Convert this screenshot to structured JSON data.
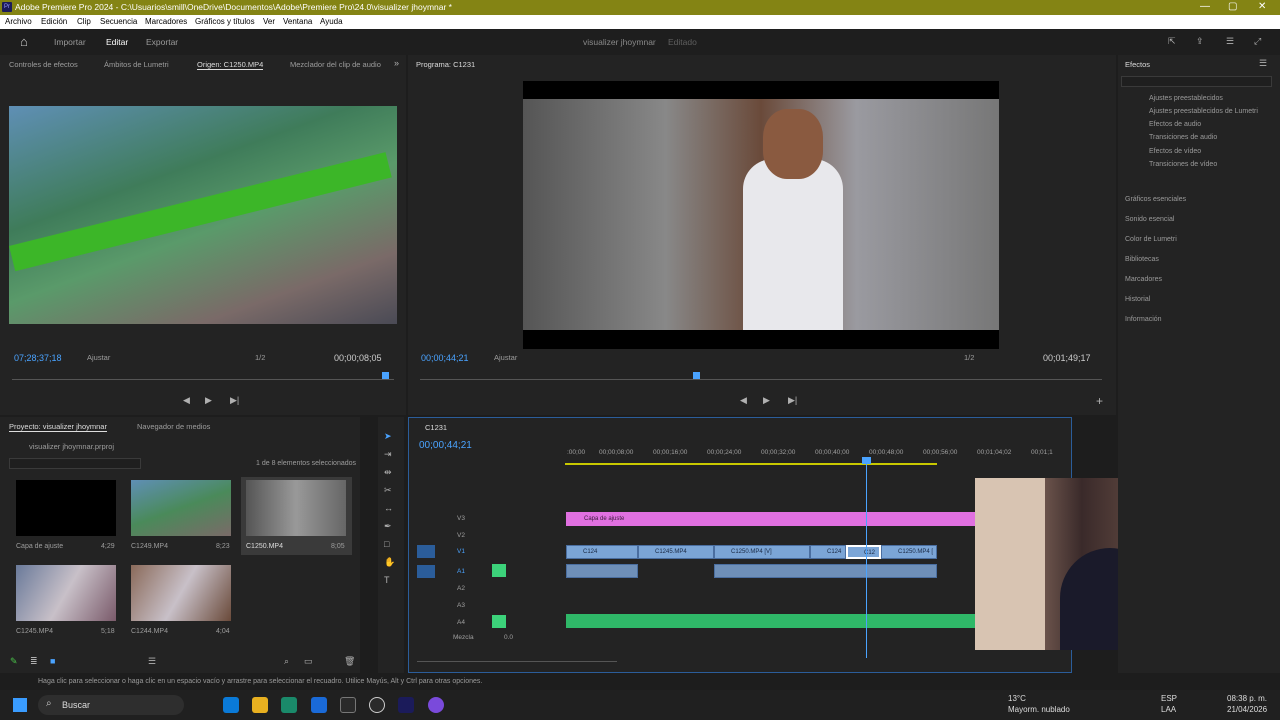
{
  "window": {
    "title": "Adobe Premiere Pro 2024 - C:\\Usuarios\\smill\\OneDrive\\Documentos\\Adobe\\Premiere Pro\\24.0\\visualizer jhoymnar *",
    "app_badge": "Pr"
  },
  "menu": [
    "Archivo",
    "Edición",
    "Clip",
    "Secuencia",
    "Marcadores",
    "Gráficos y títulos",
    "Ver",
    "Ventana",
    "Ayuda"
  ],
  "appbar": {
    "tabs": [
      "Importar",
      "Editar",
      "Exportar"
    ],
    "active": "Editar",
    "project_title": "visualizer jhoymnar",
    "project_status": "Editado"
  },
  "source": {
    "tabs": [
      "Controles de efectos",
      "Ámbitos de Lumetri",
      "Origen: C1250.MP4",
      "Mezclador del clip de audio"
    ],
    "timecode": "07;28;37;18",
    "fit": "Ajustar",
    "resolution": "1/2",
    "duration": "00;00;08;05"
  },
  "program": {
    "title": "Programa: C1231",
    "timecode": "00;00;44;21",
    "fit": "Ajustar",
    "resolution": "1/2",
    "duration": "00;01;49;17"
  },
  "project": {
    "tabs": [
      "Proyecto: visualizer jhoymnar",
      "Navegador de medios"
    ],
    "file": "visualizer jhoymnar.prproj",
    "selection": "1 de 8 elementos seleccionados",
    "items": [
      {
        "name": "Capa de ajuste",
        "dur": "4;29"
      },
      {
        "name": "C1249.MP4",
        "dur": "8;23"
      },
      {
        "name": "C1250.MP4",
        "dur": "8;05"
      },
      {
        "name": "C1245.MP4",
        "dur": "5;18"
      },
      {
        "name": "C1244.MP4",
        "dur": "4;04"
      }
    ]
  },
  "timeline": {
    "seq": "C1231",
    "timecode": "00;00;44;21",
    "ruler": [
      ":00;00",
      "00;00;08;00",
      "00;00;16;00",
      "00;00;24;00",
      "00;00;32;00",
      "00;00;40;00",
      "00;00;48;00",
      "00;00;56;00",
      "00;01;04;02",
      "00;01;1"
    ],
    "tracks": [
      "V3",
      "V2",
      "V1",
      "A1",
      "A2",
      "A3",
      "A4"
    ],
    "mix_label": "Mezcla",
    "mix_value": "0.0",
    "adjust_clip": "Capa de ajuste",
    "clips": [
      "C124",
      "C1245.MP4",
      "C1250.MP4 [V]",
      "C124",
      "C12",
      "C1250.MP4 ["
    ]
  },
  "effects": {
    "title": "Efectos",
    "folders": [
      "Ajustes preestablecidos",
      "Ajustes preestablecidos de Lumetri",
      "Efectos de audio",
      "Transiciones de audio",
      "Efectos de vídeo",
      "Transiciones de vídeo"
    ],
    "panels": [
      "Gráficos esenciales",
      "Sonido esencial",
      "Color de Lumetri",
      "Bibliotecas",
      "Marcadores",
      "Historial",
      "Información"
    ]
  },
  "status": "Haga clic para seleccionar o haga clic en un espacio vacío y arrastre para seleccionar el recuadro. Utilice Mayús, Alt y Ctrl para otras opciones.",
  "taskbar": {
    "search": "Buscar",
    "weather_temp": "13°C",
    "weather_text": "Mayorm. nublado",
    "lang": "ESP",
    "lang2": "LAA",
    "time": "08:38 p. m.",
    "date": "21/04/2026"
  }
}
